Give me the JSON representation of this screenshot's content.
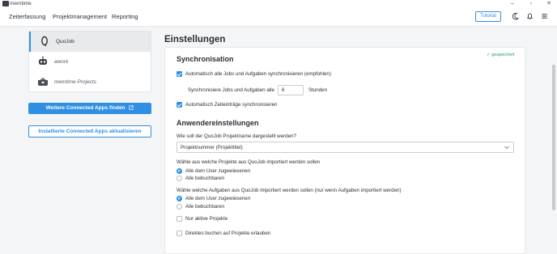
{
  "window": {
    "app_name": "memtime"
  },
  "nav": {
    "items": [
      "Zeiterfassung",
      "Projektmanagement",
      "Reporting"
    ],
    "tutorial_label": "Tutorial"
  },
  "sidebar": {
    "apps": [
      {
        "label": "QuoJob",
        "active": true
      },
      {
        "label": "awork",
        "active": false
      },
      {
        "label": "memtime Projects",
        "active": false
      }
    ],
    "find_apps_label": "Weitere Connected Apps finden",
    "update_apps_label": "Installierte Connected Apps aktualisieren"
  },
  "main": {
    "title": "Einstellungen",
    "saved_label": "gespeichert",
    "sync": {
      "title": "Synchronisation",
      "auto_sync_label": "Automatisch alle Jobs und Aufgaben synchronisieren (empfohlen)",
      "auto_sync_checked": true,
      "interval_prefix": "Synchronisiere Jobs und Aufgaben alle",
      "interval_value": "6",
      "interval_suffix": "Stunden",
      "auto_time_label": "Automatisch Zeiteinträge synchronisieren",
      "auto_time_checked": true
    },
    "user": {
      "title": "Anwendereinstellungen",
      "project_name_question": "Wie soll der QuoJob Projektname dargestellt werden?",
      "project_name_value": "Projektnummer (Projekttitel)",
      "projects_question": "Wähle aus welche Projekte aus QuoJob importiert werden sollen",
      "projects_options": [
        "Alle dem User zugewiesenen",
        "Alle bebuchbaren"
      ],
      "projects_selected": 0,
      "tasks_question": "Wähle welche Aufgaben aus QuoJob importiert werden sollen (nur wenn Aufgaben importiert werden)",
      "tasks_options": [
        "Alle dem User zugewiesenen",
        "Alle bebuchbaren"
      ],
      "tasks_selected": 0,
      "only_active_label": "Nur aktive Projekte",
      "only_active_checked": false,
      "direct_booking_label": "Direktes buchen auf Projekte erlauben",
      "direct_booking_checked": false
    }
  },
  "colors": {
    "accent": "#2f8fe3",
    "success": "#1fa463",
    "background": "#f4f5f7"
  },
  "icons": [
    "app-logo-icon",
    "minimize-icon",
    "maximize-icon",
    "close-icon",
    "moon-icon",
    "bell-icon",
    "menu-icon",
    "quojob-icon",
    "awork-icon",
    "memtime-projects-icon",
    "external-link-icon",
    "check-icon",
    "chevron-down-icon"
  ]
}
